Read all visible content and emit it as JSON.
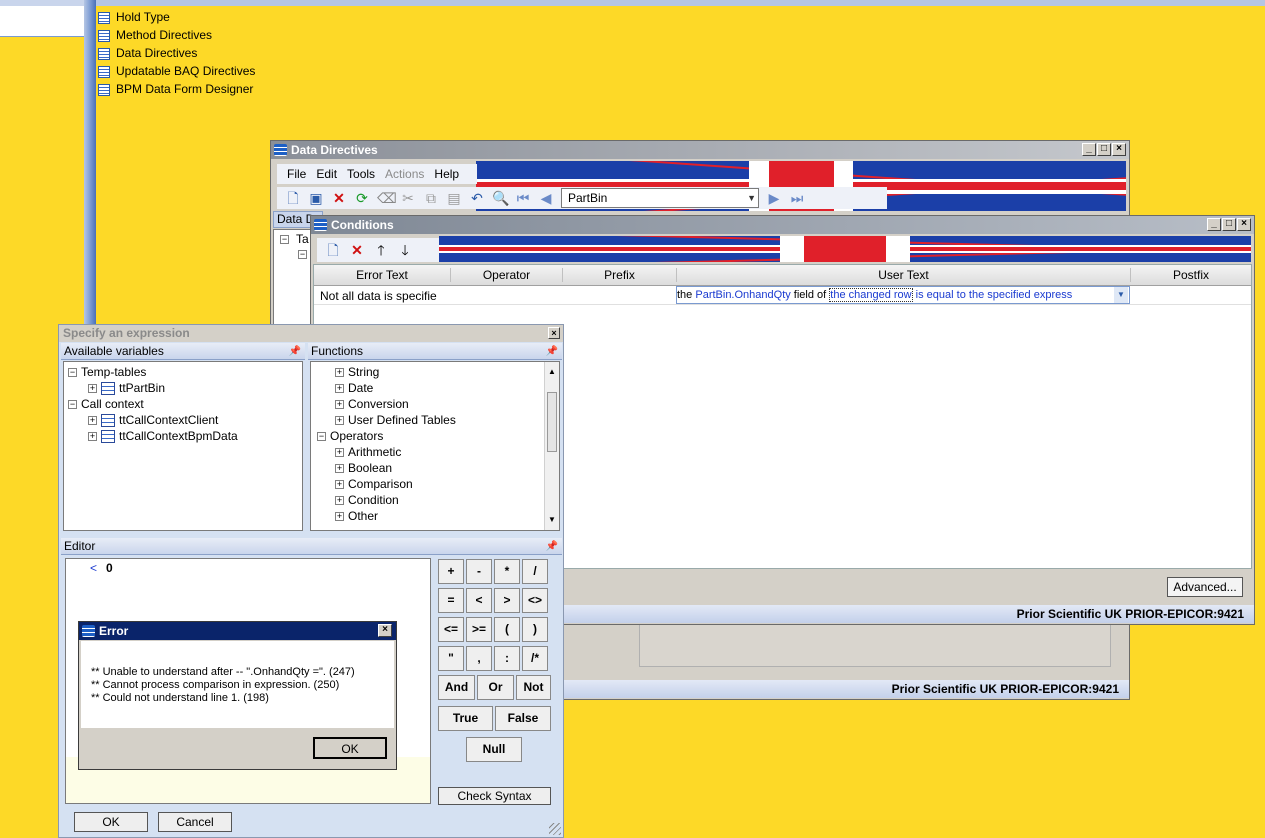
{
  "background_color": "#fdd927",
  "left_list": [
    "Hold Type",
    "Method Directives",
    "Data Directives",
    "Updatable BAQ Directives",
    "BPM Data Form Designer"
  ],
  "data_directives": {
    "title": "Data Directives",
    "menu": [
      "File",
      "Edit",
      "Tools",
      "Actions",
      "Help"
    ],
    "search_value": "PartBin",
    "tab_label": "Data D",
    "tree_stub": "Ta",
    "status": "Prior Scientific UK  PRIOR-EPICOR:9421"
  },
  "conditions": {
    "title": "Conditions",
    "columns": [
      "Error Text",
      "Operator",
      "Prefix",
      "User Text",
      "Postfix"
    ],
    "row": {
      "error_text": "Not all data is specifie",
      "ut_prefix": "the ",
      "ut_field": "PartBin.OnhandQty",
      "ut_mid": " field of ",
      "ut_changed": "the changed row",
      "ut_equal": " is equal to ",
      "ut_expr": " the specified express"
    },
    "advanced_label": "Advanced...",
    "status": "Prior Scientific UK  PRIOR-EPICOR:9421"
  },
  "expression": {
    "title": "Specify an expression",
    "variables_header": "Available variables",
    "functions_header": "Functions",
    "editor_header": "Editor",
    "variables": [
      {
        "label": "Temp-tables",
        "level": 0
      },
      {
        "label": "ttPartBin",
        "level": 1
      },
      {
        "label": "Call context",
        "level": 0
      },
      {
        "label": "ttCallContextClient",
        "level": 1
      },
      {
        "label": "ttCallContextBpmData",
        "level": 1
      }
    ],
    "functions": [
      {
        "label": "String",
        "level": 1
      },
      {
        "label": "Date",
        "level": 1
      },
      {
        "label": "Conversion",
        "level": 1
      },
      {
        "label": "User Defined Tables",
        "level": 1
      },
      {
        "label": "Operators",
        "level": 0
      },
      {
        "label": "Arithmetic",
        "level": 1
      },
      {
        "label": "Boolean",
        "level": 1
      },
      {
        "label": "Comparison",
        "level": 1
      },
      {
        "label": "Condition",
        "level": 1
      },
      {
        "label": "Other",
        "level": 1
      }
    ],
    "editor_text_op": "<",
    "editor_text_val": "0",
    "calc_row1": [
      "+",
      "-",
      "*",
      "/"
    ],
    "calc_row2": [
      "=",
      "<",
      ">",
      "<>"
    ],
    "calc_row3": [
      "<=",
      ">=",
      "(",
      ")"
    ],
    "calc_row4": [
      "\"",
      ",",
      ":",
      "/*"
    ],
    "logic": [
      "And",
      "Or",
      "Not"
    ],
    "bools": [
      "True",
      "False"
    ],
    "null_label": "Null",
    "check_syntax": "Check Syntax",
    "ok": "OK",
    "cancel": "Cancel"
  },
  "error_dialog": {
    "title": "Error",
    "lines": [
      "** Unable to understand after -- \".OnhandQty =\". (247)",
      "** Cannot process comparison in expression. (250)",
      "** Could not understand line 1. (198)"
    ],
    "ok": "OK"
  }
}
